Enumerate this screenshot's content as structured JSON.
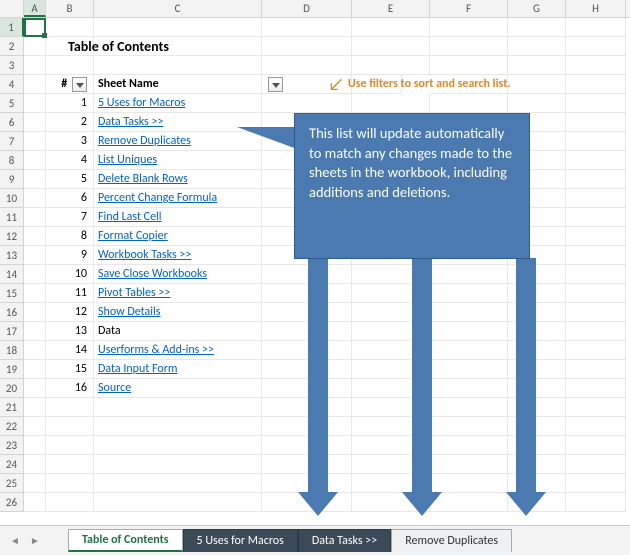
{
  "columns": [
    "A",
    "B",
    "C",
    "D",
    "E",
    "F",
    "G",
    "H"
  ],
  "title": "Table of Contents",
  "headers": {
    "num": "#",
    "name": "Sheet Name"
  },
  "hint": "Use filters to sort and search list.",
  "toc": [
    {
      "n": 1,
      "name": "5 Uses for Macros",
      "link": true
    },
    {
      "n": 2,
      "name": "Data Tasks >>",
      "link": true
    },
    {
      "n": 3,
      "name": "Remove Duplicates",
      "link": true
    },
    {
      "n": 4,
      "name": "List Uniques",
      "link": true
    },
    {
      "n": 5,
      "name": "Delete Blank Rows",
      "link": true
    },
    {
      "n": 6,
      "name": "Percent Change Formula",
      "link": true
    },
    {
      "n": 7,
      "name": "Find Last Cell",
      "link": true
    },
    {
      "n": 8,
      "name": "Format Copier",
      "link": true
    },
    {
      "n": 9,
      "name": "Workbook Tasks >>",
      "link": true
    },
    {
      "n": 10,
      "name": "Save Close Workbooks",
      "link": true
    },
    {
      "n": 11,
      "name": "Pivot Tables >>",
      "link": true
    },
    {
      "n": 12,
      "name": "Show Details",
      "link": true
    },
    {
      "n": 13,
      "name": "Data",
      "link": false
    },
    {
      "n": 14,
      "name": "Userforms & Add-ins >>",
      "link": true
    },
    {
      "n": 15,
      "name": "Data Input Form",
      "link": true
    },
    {
      "n": 16,
      "name": "Source",
      "link": true
    }
  ],
  "callout": "This list will update automatically to match any changes made to the sheets in the workbook, including additions and deletions.",
  "tabs": [
    {
      "label": "Table of Contents",
      "style": "active"
    },
    {
      "label": "5 Uses for Macros",
      "style": "dark"
    },
    {
      "label": "Data Tasks >>",
      "style": "dark"
    },
    {
      "label": "Remove Duplicates",
      "style": "light"
    }
  ],
  "active_cell": {
    "col": "A",
    "row": 1
  },
  "colors": {
    "accent": "#217346",
    "link": "#0563c1",
    "callout": "#4a7ab0",
    "hint": "#e08728"
  }
}
